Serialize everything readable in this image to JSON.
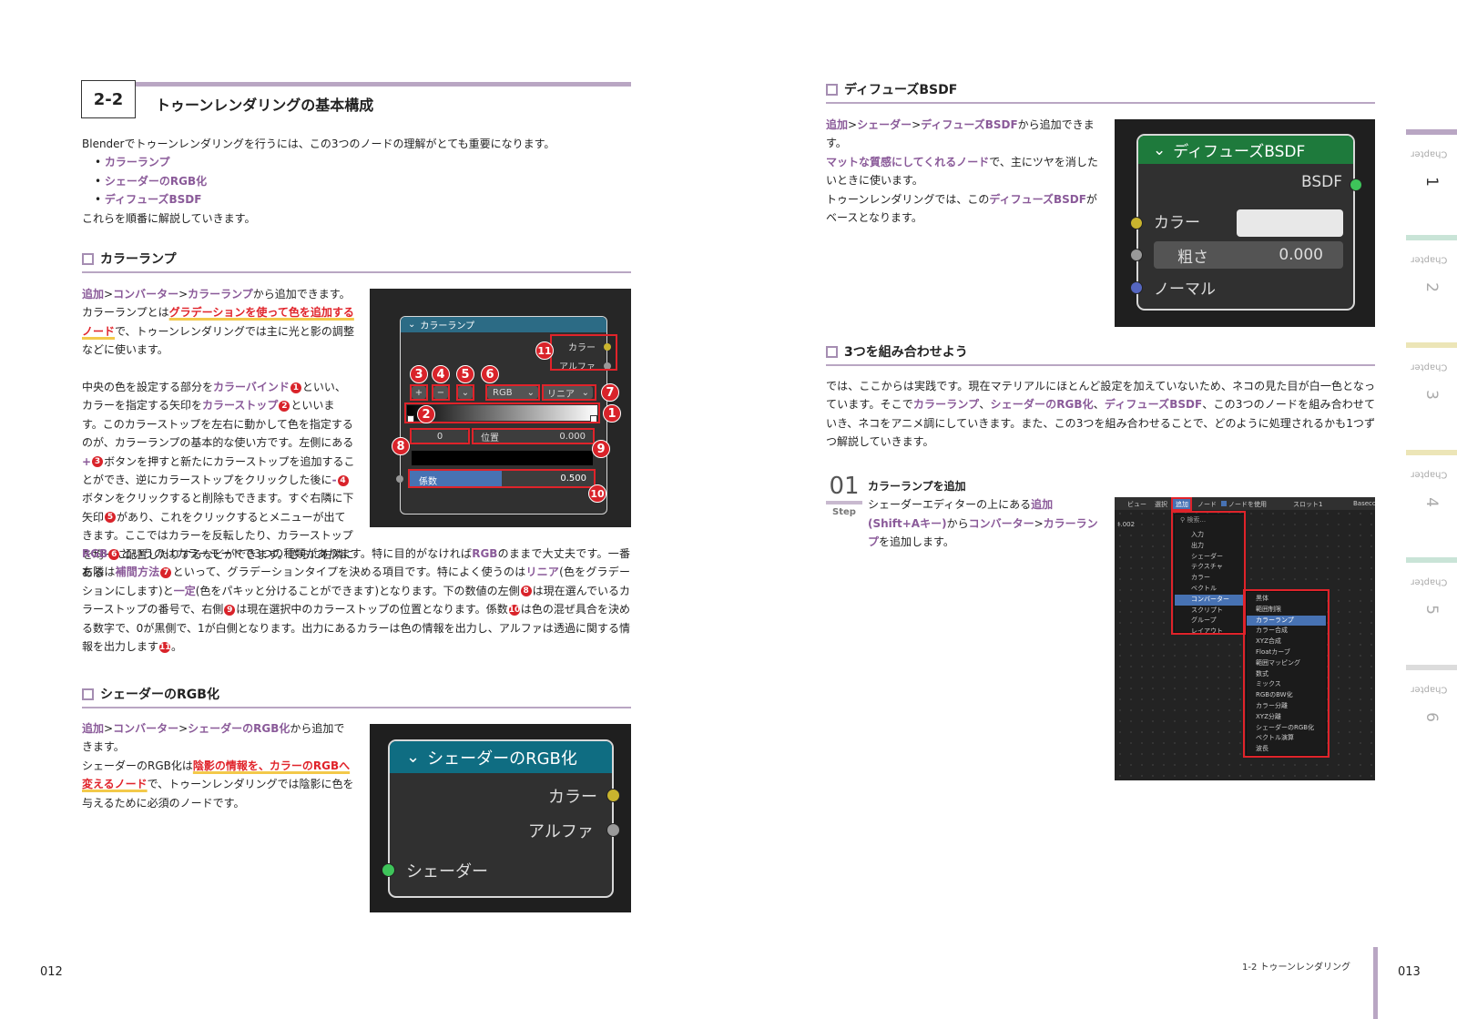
{
  "left": {
    "section_num": "2-2",
    "section_title": "トゥーンレンダリングの基本構成",
    "intro": "Blenderでトゥーンレンダリングを行うには、この3つのノードの理解がとても重要になります。",
    "bullets": [
      "カラーランプ",
      "シェーダーのRGB化",
      "ディフューズBSDF"
    ],
    "intro_end": "これらを順番に解説していきます。",
    "cr_title": "カラーランプ",
    "cr": {
      "add1": "追加",
      "gt": ">",
      "add2": "コンバーター",
      "add3": "カラーランプ",
      "add4": "から追加できます。",
      "p2a": "カラーランプとは",
      "p2b": "グラデーションを使って色を追加するノード",
      "p2c": "で、トゥーンレンダリングでは主に光と影の調整などに使います。",
      "s1": "中央の色を設定する部分を",
      "k1": "カラーバインド",
      "s2": "といい、カラーを指定する矢印を",
      "k2": "カラーストップ",
      "s3": "といいます。このカラーストップを左右に動かして色を指定するのが、カラーランプの基本的な使い方です。左側にある",
      "k3": "+",
      "s4": "ボタンを押すと新たにカラーストップを追加することができ、逆にカラーストップをクリックした後に",
      "k4": "-",
      "s5": "ボタンをクリックすると削除もできます。すぐ右隣に下矢印",
      "s6": "があり、これをクリックするとメニューが出てきます。ここではカラーを反転したり、カラーストップを均一に配置したりするなどができます。さらに右隣にある",
      "k6": "RGB",
      "s7": "というのはカラーモードで3つの種類があります。特に目的がなければ",
      "k6b": "RGB",
      "s8": "のままで大丈夫です。一番右隣は",
      "k7": "補間方法",
      "s9": "といって、グラデーションタイプを決める項目です。特によく使うのは",
      "k7a": "リニア",
      "s10": "(色をグラデーションにします)と",
      "k7b": "一定",
      "s11": "(色をパキッと分けることができます)となります。下の数値の左側",
      "s12": "は現在選んでいるカラーストップの番号で、右側",
      "s13": "は現在選択中のカラーストップの位置となります。係数",
      "s14": "は色の混ぜ具合を決める数字で、0が黒側で、1が白側となります。出力にあるカラーは色の情報を出力し、アルファは透過に関する情報を出力します"
    },
    "cr_node": {
      "title": "カラーランプ",
      "out1": "カラー",
      "out2": "アルファ",
      "mode": "RGB",
      "interp": "リニア",
      "idx": "0",
      "pos_label": "位置",
      "pos_val": "0.000",
      "fac_label": "係数",
      "fac_val": "0.500",
      "plus": "+",
      "minus": "−",
      "chev": "⌄"
    },
    "badges": [
      "1",
      "2",
      "3",
      "4",
      "5",
      "6",
      "7",
      "8",
      "9",
      "10",
      "11"
    ],
    "srgb_title": "シェーダーのRGB化",
    "srgb": {
      "add1": "追加",
      "gt": ">",
      "add2": "コンバーター",
      "add3": "シェーダーのRGB化",
      "add4": "から追加できます。",
      "p2a": "シェーダーのRGB化は",
      "p2b": "陰影の情報を、カラーのRGBへ変えるノード",
      "p2c": "で、トゥーンレンダリングでは陰影に色を与えるために必須のノードです。"
    },
    "srgb_node": {
      "title": "シェーダーのRGB化",
      "out1": "カラー",
      "out2": "アルファ",
      "in1": "シェーダー"
    },
    "page_num": "012"
  },
  "right": {
    "diff_title": "ディフューズBSDF",
    "diff": {
      "add1": "追加",
      "gt": ">",
      "add2": "シェーダー",
      "add3": "ディフューズBSDF",
      "add4": "から追加できます。",
      "p2a": "マットな質感にしてくれるノード",
      "p2b": "で、主にツヤを消したいときに使います。",
      "p3a": "トゥーンレンダリングでは、この",
      "p3b": "ディフューズBSDF",
      "p3c": "がベースとなります。"
    },
    "diff_node": {
      "title": "ディフューズBSDF",
      "out": "BSDF",
      "in1": "カラー",
      "in2": "粗さ",
      "in2_val": "0.000",
      "in3": "ノーマル"
    },
    "combo_title": "3つを組み合わせよう",
    "combo": {
      "a": "では、ここからは実践です。現在マテリアルにほとんど設定を加えていないため、ネコの見た目が白一色となっています。そこで",
      "k1": "カラーランプ",
      "sep": "、",
      "k2": "シェーダーのRGB化",
      "k3": "ディフューズBSDF",
      "b": "、この3つのノードを組み合わせていき、ネコをアニメ調にしていきます。また、この3つを組み合わせることで、どのように処理されるかも1つずつ解説していきます。"
    },
    "step": {
      "num": "01",
      "label": "Step",
      "title": "カラーランプを追加",
      "a": "シェーダーエディターの上にある",
      "k1": "追加",
      "k1b": "(Shift+Aキー)",
      "b": "から",
      "k2": "コンバーター",
      "k3": "カラーランプ",
      "c": "を追加します。"
    },
    "menu": {
      "topbar": [
        "ビュー",
        "選択",
        "追加",
        "ノード",
        "ノードを使用",
        "スロット1",
        "Baseco"
      ],
      "left_label": "ｷ.002",
      "search": "検索...",
      "main": [
        "入力",
        "出力",
        "シェーダー",
        "テクスチャ",
        "カラー",
        "ベクトル",
        "コンバーター",
        "スクリプト",
        "グループ",
        "レイアウト"
      ],
      "sub": [
        "黒体",
        "範囲制限",
        "カラーランプ",
        "カラー合成",
        "XYZ合成",
        "Floatカーブ",
        "範囲マッピング",
        "数式",
        "ミックス",
        "RGBのBW化",
        "カラー分離",
        "XYZ分離",
        "シェーダーのRGB化",
        "ベクトル演算",
        "波長"
      ]
    },
    "footer": "1-2 トゥーンレンダリング",
    "page_num": "013",
    "tabs": [
      {
        "label": "Chapter",
        "num": "1"
      },
      {
        "label": "Chapter",
        "num": "2"
      },
      {
        "label": "Chapter",
        "num": "3"
      },
      {
        "label": "Chapter",
        "num": "4"
      },
      {
        "label": "Chapter",
        "num": "5"
      },
      {
        "label": "Chapter",
        "num": "6"
      }
    ]
  },
  "colors": {
    "accent": "#8a5a99",
    "red": "#e0232a",
    "tab1": "#b9a6c3",
    "tab2": "#c9e4d7",
    "tab3": "#ece5b7",
    "tab4": "#ece5b7",
    "tab5": "#c9e4d7",
    "tab6": "#dcdcdc"
  }
}
